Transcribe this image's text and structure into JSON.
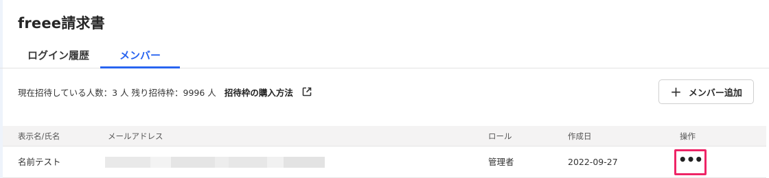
{
  "app": {
    "title": "freee請求書"
  },
  "tabs": [
    {
      "label": "ログイン履歴",
      "active": false
    },
    {
      "label": "メンバー",
      "active": true
    }
  ],
  "invite": {
    "summary": "現在招待している人数：3 人 残り招待枠：9996 人",
    "purchase_link": "招待枠の購入方法",
    "purchase_icon": "external-link-icon"
  },
  "add_member_button": {
    "icon": "plus-icon",
    "label": "メンバー追加"
  },
  "table": {
    "headers": {
      "name": "表示名/氏名",
      "email": "メールアドレス",
      "role": "ロール",
      "created": "作成日",
      "ops": "操作"
    },
    "rows": [
      {
        "name": "名前テスト",
        "email": "",
        "role": "管理者",
        "created": "2022-09-27",
        "ops_icon": "more-horizontal-icon"
      }
    ]
  },
  "colors": {
    "accent": "#2864f0",
    "highlight": "#ee2466",
    "header_bg": "#f4f3f3"
  }
}
